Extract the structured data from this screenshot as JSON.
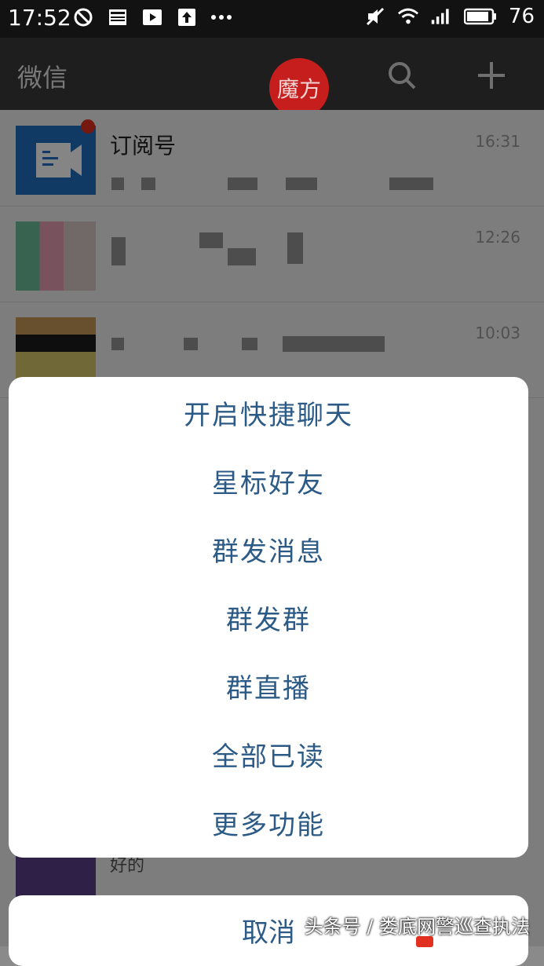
{
  "status_bar": {
    "time": "17:52",
    "battery": "76",
    "icons_left": [
      "clock-blocked-icon",
      "news-icon",
      "play-icon",
      "upload-icon",
      "more-dots-icon"
    ],
    "icons_right": [
      "mute-icon",
      "wifi-icon",
      "signal-icon",
      "battery-icon"
    ]
  },
  "header": {
    "title": "微信",
    "badge": "魔方",
    "search_icon": "search-icon",
    "add_icon": "plus-icon"
  },
  "chats": [
    {
      "name": "订阅号",
      "time": "16:31"
    },
    {
      "name": "",
      "time": "12:26"
    },
    {
      "name": "",
      "time": "10:03"
    }
  ],
  "hidden_row_preview": "好的",
  "menu": {
    "items": [
      "开启快捷聊天",
      "星标好友",
      "群发消息",
      "群发群",
      "群直播",
      "全部已读",
      "更多功能"
    ],
    "cancel": "取消"
  },
  "watermark": "头条号 / 娄底网警巡查执法",
  "colors": {
    "accent_text": "#2b5a86",
    "badge": "#c61d1d",
    "unread": "#e1301f"
  }
}
